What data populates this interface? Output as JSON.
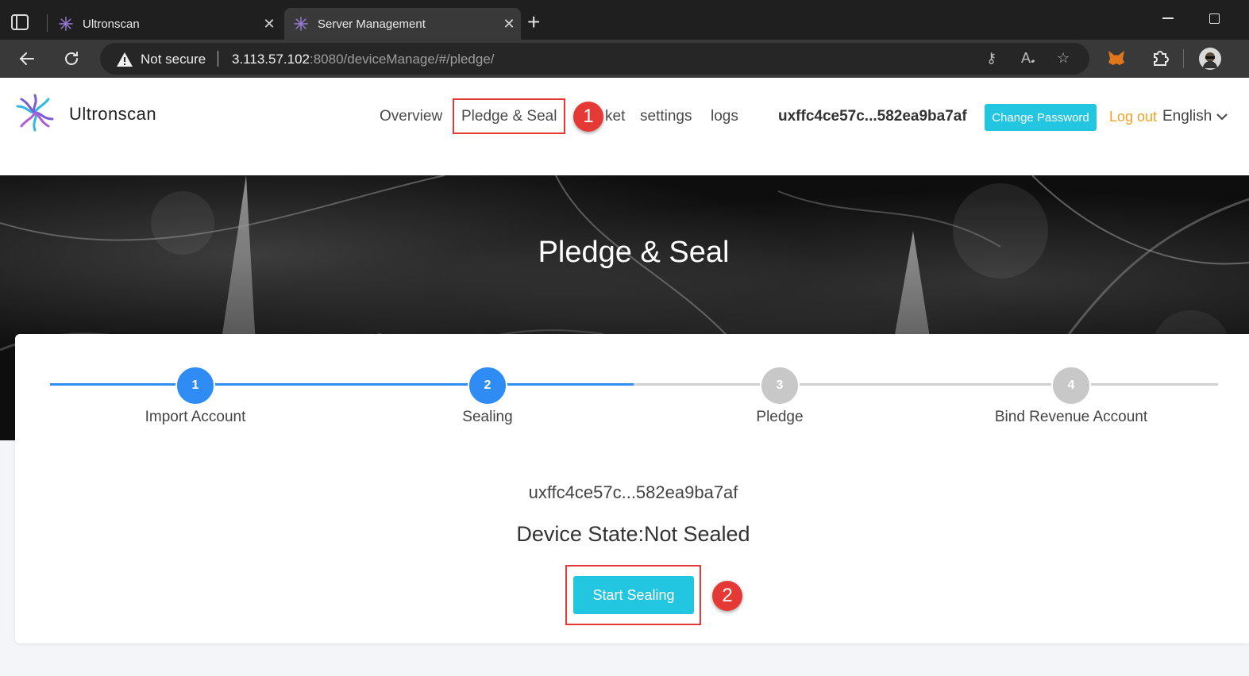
{
  "browser": {
    "tabs": [
      {
        "title": "Ultronscan"
      },
      {
        "title": "Server Management"
      }
    ],
    "address_bar": {
      "security_label": "Not secure",
      "url_host": "3.113.57.102",
      "url_rest": ":8080/deviceManage/#/pledge/"
    }
  },
  "header": {
    "logo_text": "Ultronscan",
    "nav": {
      "overview": "Overview",
      "pledge_seal": "Pledge & Seal",
      "market_fragment": "ket",
      "settings": "settings",
      "logs": "logs"
    },
    "account": "uxffc4ce57c...582ea9ba7af",
    "change_password": "Change Password",
    "logout": "Log out",
    "language": "English"
  },
  "hero": {
    "title": "Pledge & Seal"
  },
  "steps": [
    {
      "number": "1",
      "label": "Import Account",
      "state": "active"
    },
    {
      "number": "2",
      "label": "Sealing",
      "state": "active"
    },
    {
      "number": "3",
      "label": "Pledge",
      "state": "inactive"
    },
    {
      "number": "4",
      "label": "Bind Revenue Account",
      "state": "inactive"
    }
  ],
  "device": {
    "account": "uxffc4ce57c...582ea9ba7af",
    "state_text": "Device State:Not Sealed",
    "start_button": "Start Sealing"
  },
  "annotations": [
    "1",
    "2"
  ],
  "colors": {
    "accent": "#23c6e0",
    "step_active": "#2f8cf5",
    "step_inactive": "#c8c8c8",
    "logout": "#f0a020",
    "annotation": "#e53935"
  }
}
